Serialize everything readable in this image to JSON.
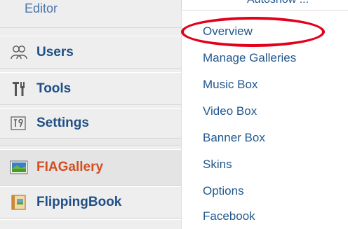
{
  "sidebar": {
    "items": [
      {
        "label": "Editor",
        "icon": "none"
      },
      {
        "label": "Users",
        "icon": "users-icon"
      },
      {
        "label": "Tools",
        "icon": "tools-icon"
      },
      {
        "label": "Settings",
        "icon": "settings-icon"
      },
      {
        "label": "FIAGallery",
        "icon": "gallery-icon",
        "active": true
      },
      {
        "label": "FlippingBook",
        "icon": "book-icon"
      }
    ]
  },
  "submenu": {
    "top_cut_text": "Autoshow ...",
    "items": [
      "Overview",
      "Manage Galleries",
      "Music Box",
      "Video Box",
      "Banner Box",
      "Skins",
      "Options",
      "Facebook"
    ],
    "highlighted": "Overview"
  },
  "colors": {
    "menu_link": "#1f4f86",
    "active_label": "#d54e21",
    "submenu_link": "#21588f",
    "highlight_circle": "#e3001b",
    "sidebar_bg": "#eeeeee"
  }
}
